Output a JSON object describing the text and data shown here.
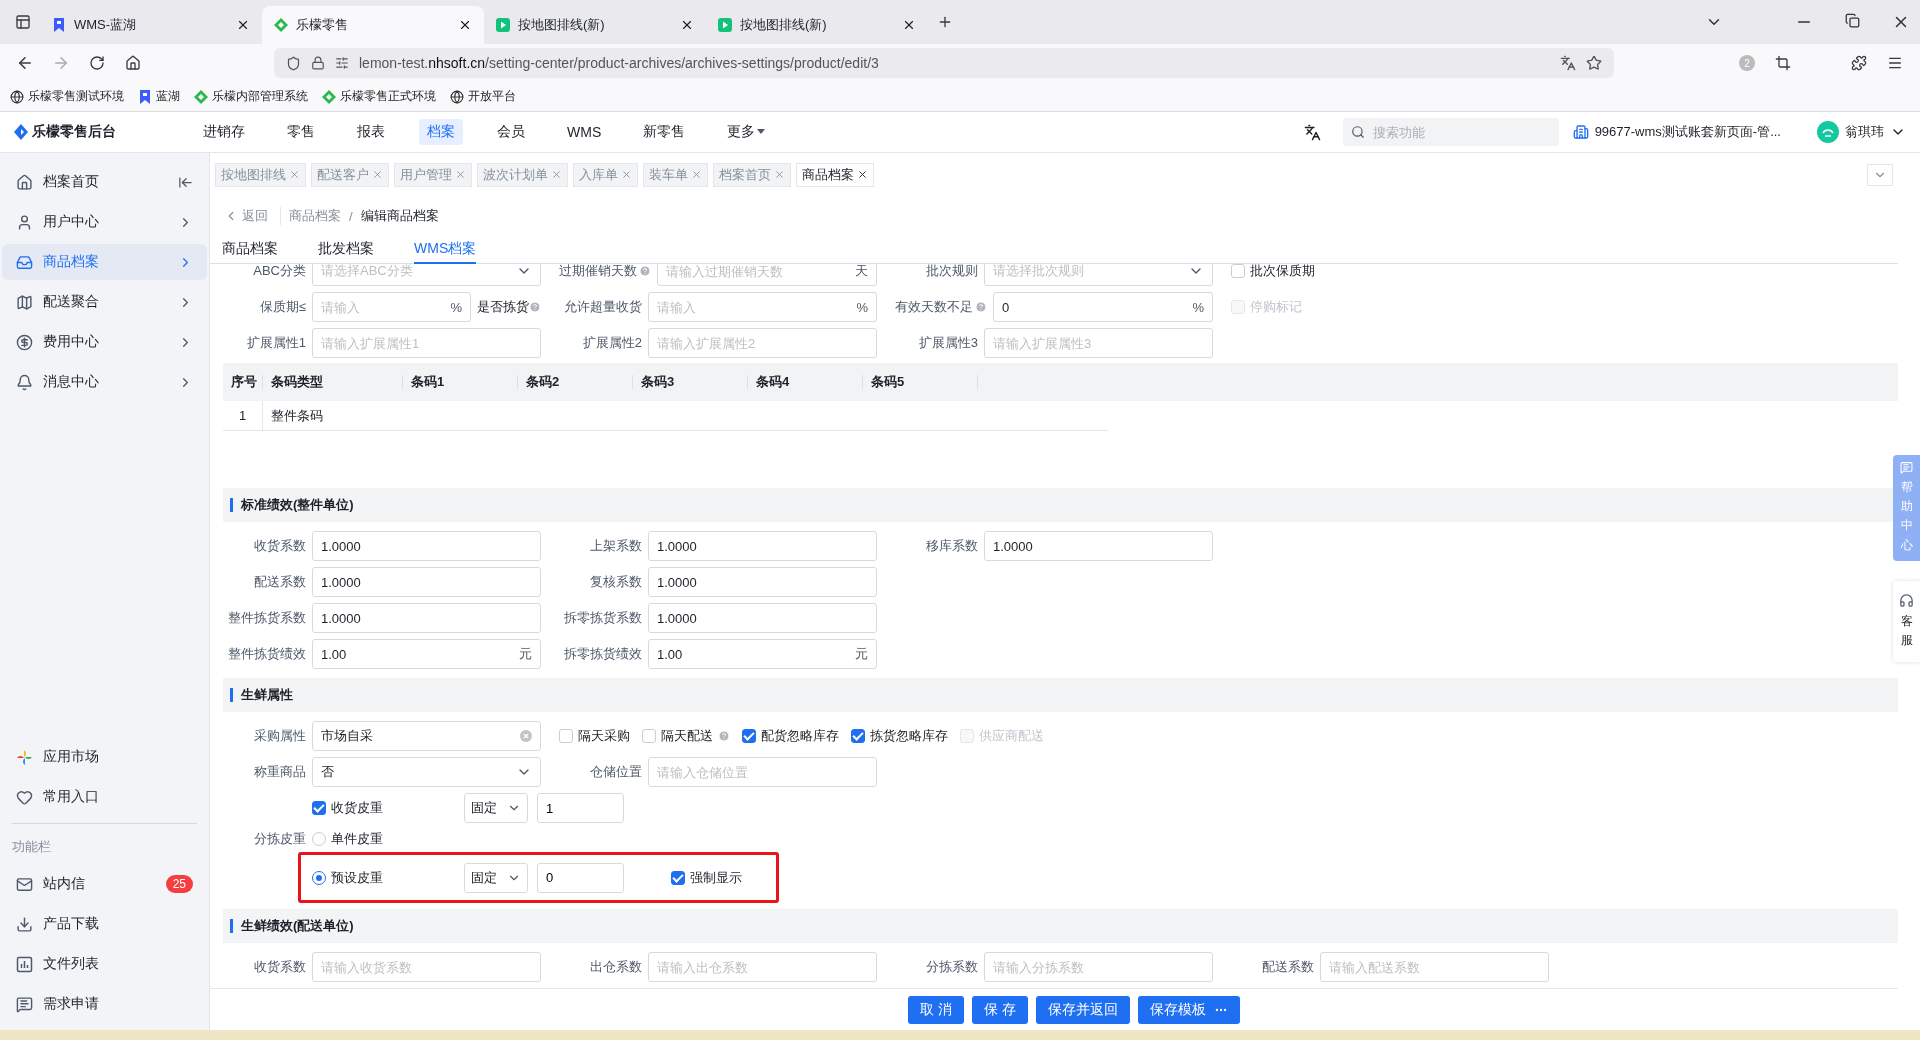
{
  "browser": {
    "tabs": [
      {
        "title": "WMS-蓝湖",
        "selected": false,
        "kind": "lanhu"
      },
      {
        "title": "乐檬零售",
        "selected": true,
        "kind": "lemon"
      },
      {
        "title": "按地图排线(新)",
        "selected": false,
        "kind": "play"
      },
      {
        "title": "按地图排线(新)",
        "selected": false,
        "kind": "play"
      }
    ],
    "url": "lemon-test.**nhsoft.cn**/setting-center/product-archives/archives-settings/product/edit/3",
    "extension_badge": "2",
    "bookmarks": [
      {
        "title": "乐檬零售测试环境",
        "kind": "globe"
      },
      {
        "title": "蓝湖",
        "kind": "lanhu"
      },
      {
        "title": "乐檬内部管理系统",
        "kind": "lemon"
      },
      {
        "title": "乐檬零售正式环境",
        "kind": "lemon"
      },
      {
        "title": "开放平台",
        "kind": "globe"
      }
    ]
  },
  "app": {
    "logo": "乐檬零售后台",
    "nav": [
      {
        "label": "进销存",
        "selected": false
      },
      {
        "label": "零售",
        "selected": false
      },
      {
        "label": "报表",
        "selected": false
      },
      {
        "label": "档案",
        "selected": true
      },
      {
        "label": "会员",
        "selected": false
      },
      {
        "label": "WMS",
        "selected": false
      },
      {
        "label": "新零售",
        "selected": false
      },
      {
        "label": "更多",
        "selected": false,
        "dropdown": true
      }
    ],
    "search_placeholder": "搜索功能",
    "account": "99677-wms测试账套新页面-管...",
    "user": "翁琪玮"
  },
  "sidebar": {
    "items": [
      {
        "label": "档案首页",
        "kind": "home",
        "selected": false
      },
      {
        "label": "用户中心",
        "kind": "user",
        "selected": false
      },
      {
        "label": "商品档案",
        "kind": "archive",
        "selected": true
      },
      {
        "label": "配送聚合",
        "kind": "map",
        "selected": false
      },
      {
        "label": "费用中心",
        "kind": "fee",
        "selected": false
      },
      {
        "label": "消息中心",
        "kind": "bell",
        "selected": false
      }
    ],
    "bottom": [
      {
        "label": "应用市场",
        "kind": "apps"
      },
      {
        "label": "常用入口",
        "kind": "heart"
      }
    ],
    "section_label": "功能栏",
    "tools": [
      {
        "label": "站内信",
        "kind": "mail",
        "badge": "25"
      },
      {
        "label": "产品下载",
        "kind": "download"
      },
      {
        "label": "文件列表",
        "kind": "chart"
      },
      {
        "label": "需求申请",
        "kind": "message"
      }
    ]
  },
  "page_tabs": [
    {
      "label": "按地图排线",
      "selected": false
    },
    {
      "label": "配送客户",
      "selected": false
    },
    {
      "label": "用户管理",
      "selected": false
    },
    {
      "label": "波次计划单",
      "selected": false
    },
    {
      "label": "入库单",
      "selected": false
    },
    {
      "label": "装车单",
      "selected": false
    },
    {
      "label": "档案首页",
      "selected": false
    },
    {
      "label": "商品档案",
      "selected": true
    }
  ],
  "breadcrumb": {
    "back": "返回",
    "path": [
      "商品档案",
      "编辑商品档案"
    ],
    "separator": "/"
  },
  "subtabs": [
    {
      "label": "商品档案",
      "selected": false
    },
    {
      "label": "批发档案",
      "selected": false
    },
    {
      "label": "WMS档案",
      "selected": true
    }
  ],
  "sections": [
    {
      "rows": [
        [
          {
            "kind": "select",
            "label": "ABC分类",
            "placeholder": "请选择ABC分类"
          },
          {
            "kind": "input",
            "label": "过期催销天数",
            "help": true,
            "placeholder": "请输入过期催销天数",
            "suffix": "天"
          },
          {
            "kind": "select",
            "label": "批次规则",
            "placeholder": "请选择批次规则"
          },
          {
            "kind": "checkbox",
            "label": "批次保质期",
            "checked": false,
            "disabled": false
          }
        ],
        [
          {
            "kind": "input",
            "label": "保质期≤",
            "placeholder": "请输入",
            "suffix": "%",
            "note": "是否拣货",
            "note_help": true
          },
          {
            "kind": "input",
            "label": "允许超量收货",
            "placeholder": "请输入",
            "suffix": "%"
          },
          {
            "kind": "input",
            "label": "有效天数不足",
            "help": true,
            "value": "0",
            "suffix": "%"
          },
          {
            "kind": "checkbox",
            "label": "停购标记",
            "checked": false,
            "disabled": true
          }
        ],
        [
          {
            "kind": "input",
            "label": "扩展属性1",
            "placeholder": "请输入扩展属性1"
          },
          {
            "kind": "input",
            "label": "扩展属性2",
            "placeholder": "请输入扩展属性2"
          },
          {
            "kind": "input",
            "label": "扩展属性3",
            "placeholder": "请输入扩展属性3"
          }
        ]
      ],
      "table": {
        "columns": [
          "序号",
          "条码类型",
          "条码1",
          "条码2",
          "条码3",
          "条码4",
          "条码5"
        ],
        "rows": [
          [
            "1",
            "整件条码"
          ]
        ]
      }
    },
    {
      "title": "标准绩效(整件单位)",
      "rows": [
        [
          {
            "kind": "input",
            "label": "收货系数",
            "value": "1.0000"
          },
          {
            "kind": "input",
            "label": "上架系数",
            "value": "1.0000"
          },
          {
            "kind": "input",
            "label": "移库系数",
            "value": "1.0000"
          }
        ],
        [
          {
            "kind": "input",
            "label": "配送系数",
            "value": "1.0000"
          },
          {
            "kind": "input",
            "label": "复核系数",
            "value": "1.0000"
          }
        ],
        [
          {
            "kind": "input",
            "label": "整件拣货系数",
            "value": "1.0000"
          },
          {
            "kind": "input",
            "label": "拆零拣货系数",
            "value": "1.0000"
          }
        ],
        [
          {
            "kind": "input",
            "label": "整件拣货绩效",
            "value": "1.00",
            "suffix": "元"
          },
          {
            "kind": "input",
            "label": "拆零拣货绩效",
            "value": "1.00",
            "suffix": "元"
          }
        ]
      ]
    },
    {
      "title": "生鲜属性",
      "rows": [
        [
          {
            "kind": "input",
            "label": "采购属性",
            "value": "市场自采",
            "clearable": true
          },
          {
            "kind": "checkbox",
            "label": "隔天采购",
            "checked": false,
            "disabled": false
          },
          {
            "kind": "checkbox",
            "label": "隔天配送",
            "checked": false,
            "disabled": false,
            "help": true
          },
          {
            "kind": "checkbox",
            "label": "配货忽略库存",
            "checked": true,
            "disabled": false
          },
          {
            "kind": "checkbox",
            "label": "拣货忽略库存",
            "checked": true,
            "disabled": false
          },
          {
            "kind": "checkbox",
            "label": "供应商配送",
            "checked": false,
            "disabled": true
          }
        ],
        [
          {
            "kind": "select",
            "label": "称重商品",
            "value": "否"
          },
          {
            "kind": "input",
            "label": "仓储位置",
            "placeholder": "请输入仓储位置"
          }
        ]
      ],
      "tare": {
        "label": "分拣皮重",
        "receive": {
          "label": "收货皮重",
          "checked": true,
          "mode": "固定",
          "value": "1"
        },
        "options": [
          {
            "label": "单件皮重",
            "selected": false,
            "highlighted": false
          },
          {
            "label": "预设皮重",
            "selected": true,
            "highlighted": true,
            "mode": "固定",
            "value": "0",
            "force": {
              "label": "强制显示",
              "checked": true
            }
          }
        ]
      }
    },
    {
      "title": "生鲜绩效(配送单位)",
      "rows": [
        [
          {
            "kind": "input",
            "label": "收货系数",
            "placeholder": "请输入收货系数"
          },
          {
            "kind": "input",
            "label": "出仓系数",
            "placeholder": "请输入出仓系数"
          },
          {
            "kind": "input",
            "label": "分拣系数",
            "placeholder": "请输入分拣系数"
          },
          {
            "kind": "input",
            "label": "配送系数",
            "placeholder": "请输入配送系数"
          }
        ]
      ]
    }
  ],
  "footer": [
    {
      "label": "取 消"
    },
    {
      "label": "保 存"
    },
    {
      "label": "保存并返回"
    },
    {
      "label": "保存模板",
      "menu": true
    }
  ],
  "side_tabs": {
    "help": "帮助中心",
    "service": "客服"
  }
}
